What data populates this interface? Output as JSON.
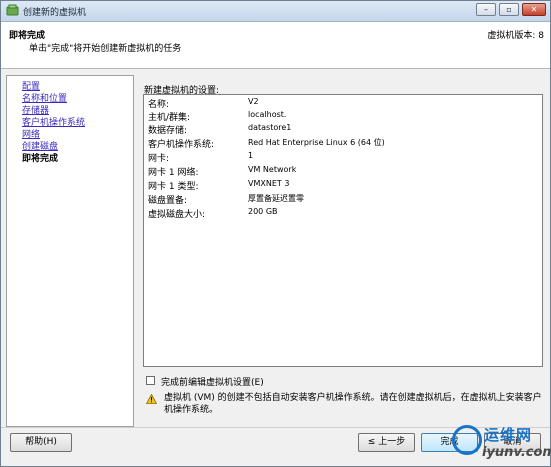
{
  "window": {
    "title": "创建新的虚拟机",
    "colors": {
      "title_gradient": "#c4d6ea",
      "close": "#c4412b"
    }
  },
  "header": {
    "title": "即将完成",
    "subtitle": "单击\"完成\"将开始创建新虚拟机的任务",
    "version": "虚拟机版本: 8"
  },
  "nav": {
    "items": [
      {
        "label": "配置"
      },
      {
        "label": "名称和位置"
      },
      {
        "label": "存储器"
      },
      {
        "label": "客户机操作系统"
      },
      {
        "label": "网络"
      },
      {
        "label": "创建磁盘"
      },
      {
        "label": "即将完成"
      }
    ]
  },
  "settings": {
    "heading": "新建虚拟机的设置:",
    "rows": [
      {
        "key": "名称:",
        "value": "V2"
      },
      {
        "key": "主机/群集:",
        "value": "localhost."
      },
      {
        "key": "数据存储:",
        "value": "datastore1"
      },
      {
        "key": "客户机操作系统:",
        "value": "Red Hat Enterprise Linux 6 (64 位)"
      },
      {
        "key": "网卡:",
        "value": "1"
      },
      {
        "key": "网卡 1 网络:",
        "value": "VM Network"
      },
      {
        "key": "网卡 1 类型:",
        "value": "VMXNET 3"
      },
      {
        "key": "磁盘置备:",
        "value": "厚置备延迟置零"
      },
      {
        "key": "虚拟磁盘大小:",
        "value": "200 GB"
      }
    ]
  },
  "edit_checkbox": {
    "label": "完成前编辑虚拟机设置(E)",
    "checked": false
  },
  "warning": {
    "icon": "warning-icon",
    "text": "虚拟机 (VM) 的创建不包括自动安装客户机操作系统。请在创建虚拟机后，在虚拟机上安装客户机操作系统。"
  },
  "buttons": {
    "help": "帮助(H)",
    "back": "≤ 上一步",
    "finish": "完成",
    "cancel": "取消"
  },
  "watermark": {
    "text": "运维网",
    "sub": "iyunv.com"
  }
}
